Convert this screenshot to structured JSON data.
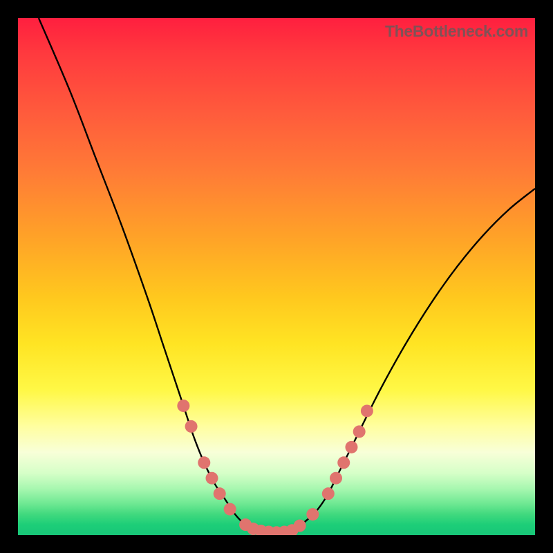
{
  "watermark": "TheBottleneck.com",
  "colors": {
    "frame": "#000000",
    "curve_stroke": "#000000",
    "marker_fill": "#e0746e",
    "marker_stroke": "#cc5a55"
  },
  "chart_data": {
    "type": "line",
    "title": "",
    "xlabel": "",
    "ylabel": "",
    "xlim": [
      0,
      100
    ],
    "ylim": [
      0,
      100
    ],
    "y_direction_note": "y=0 at bottom (green zone); y=100 at top (red zone)",
    "series": [
      {
        "name": "bottleneck-curve",
        "x": [
          4,
          10,
          15,
          20,
          25,
          28,
          30,
          32,
          34,
          36,
          38,
          40,
          42,
          44,
          46,
          48,
          50,
          52,
          54,
          56,
          58,
          60,
          62,
          65,
          70,
          75,
          80,
          85,
          90,
          95,
          100
        ],
        "y": [
          100,
          86,
          73,
          60,
          46,
          37,
          31,
          25,
          19,
          14,
          10,
          7,
          4,
          2,
          1,
          0.5,
          0.5,
          0.7,
          1.5,
          3,
          5,
          8,
          12,
          18,
          28,
          37,
          45,
          52,
          58,
          63,
          67
        ]
      }
    ],
    "markers": {
      "name": "highlighted-points",
      "note": "salmon dots visible on the curve in the lower (green/yellow) region",
      "points": [
        {
          "x": 32,
          "y": 25
        },
        {
          "x": 33.5,
          "y": 21
        },
        {
          "x": 36,
          "y": 14
        },
        {
          "x": 37.5,
          "y": 11
        },
        {
          "x": 39,
          "y": 8
        },
        {
          "x": 41,
          "y": 5
        },
        {
          "x": 44,
          "y": 2
        },
        {
          "x": 45.5,
          "y": 1.2
        },
        {
          "x": 47,
          "y": 0.8
        },
        {
          "x": 48.5,
          "y": 0.6
        },
        {
          "x": 50,
          "y": 0.5
        },
        {
          "x": 51.5,
          "y": 0.6
        },
        {
          "x": 53,
          "y": 0.9
        },
        {
          "x": 54.5,
          "y": 1.8
        },
        {
          "x": 57,
          "y": 4
        },
        {
          "x": 60,
          "y": 8
        },
        {
          "x": 61.5,
          "y": 11
        },
        {
          "x": 63,
          "y": 14
        },
        {
          "x": 64.5,
          "y": 17
        },
        {
          "x": 66,
          "y": 20
        },
        {
          "x": 67.5,
          "y": 24
        }
      ]
    }
  }
}
